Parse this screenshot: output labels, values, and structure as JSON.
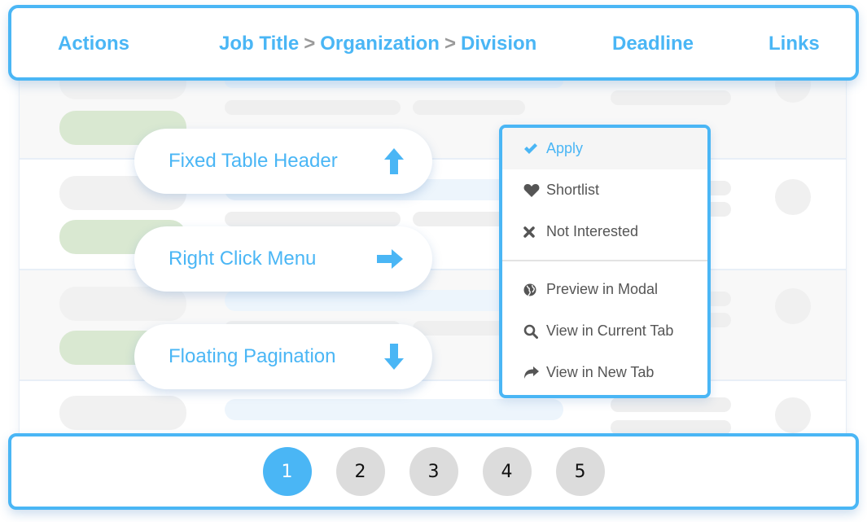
{
  "header": {
    "columns": {
      "actions": "Actions",
      "job_title": "Job Title",
      "organization": "Organization",
      "division": "Division",
      "separator": ">",
      "deadline": "Deadline",
      "links": "Links"
    }
  },
  "features": [
    {
      "label": "Fixed Table Header",
      "icon": "arrow-up-icon"
    },
    {
      "label": "Right Click Menu",
      "icon": "arrow-right-icon"
    },
    {
      "label": "Floating Pagination",
      "icon": "arrow-down-icon"
    }
  ],
  "context_menu": {
    "items": [
      {
        "label": "Apply",
        "icon": "check-icon",
        "active": true
      },
      {
        "label": "Shortlist",
        "icon": "heart-icon"
      },
      {
        "label": "Not Interested",
        "icon": "x-icon"
      },
      {
        "label": "Preview in Modal",
        "icon": "globe-icon"
      },
      {
        "label": "View in Current Tab",
        "icon": "search-icon"
      },
      {
        "label": "View in New Tab",
        "icon": "share-arrow-icon"
      }
    ]
  },
  "pagination": {
    "pages": [
      "1",
      "2",
      "3",
      "4",
      "5"
    ],
    "current": "1"
  },
  "colors": {
    "accent": "#4ab6f5",
    "menu_text": "#555555",
    "page_inactive": "#dcdcdc",
    "skeleton_green": "#d9e8d1"
  }
}
